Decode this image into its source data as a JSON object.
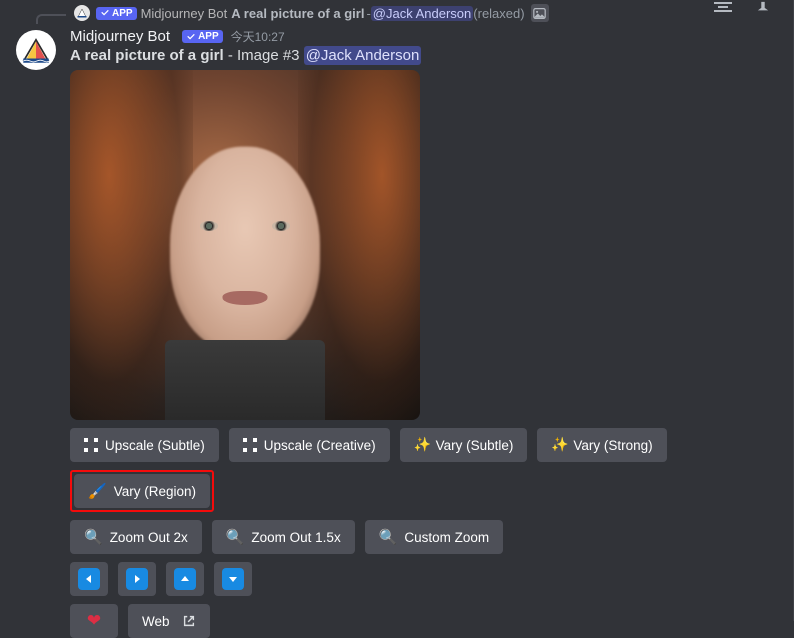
{
  "reply": {
    "app_badge": "APP",
    "bot_name": "Midjourney Bot",
    "prompt_summary": "A real picture of a girl",
    "dash": " - ",
    "mention": "@Jack Anderson",
    "suffix": " (relaxed)"
  },
  "message": {
    "username": "Midjourney Bot",
    "app_badge": "APP",
    "timestamp": "今天10:27",
    "prompt_text": "A real picture of a girl",
    "image_label": " - Image #3 ",
    "mention": "@Jack Anderson"
  },
  "buttons": {
    "row1": {
      "upscale_subtle": "Upscale (Subtle)",
      "upscale_creative": "Upscale (Creative)",
      "vary_subtle": "Vary (Subtle)",
      "vary_strong": "Vary (Strong)"
    },
    "row2": {
      "vary_region": "Vary (Region)"
    },
    "row3": {
      "zoom2x": "Zoom Out 2x",
      "zoom15x": "Zoom Out 1.5x",
      "custom_zoom": "Custom Zoom"
    },
    "row5": {
      "web": "Web"
    }
  }
}
